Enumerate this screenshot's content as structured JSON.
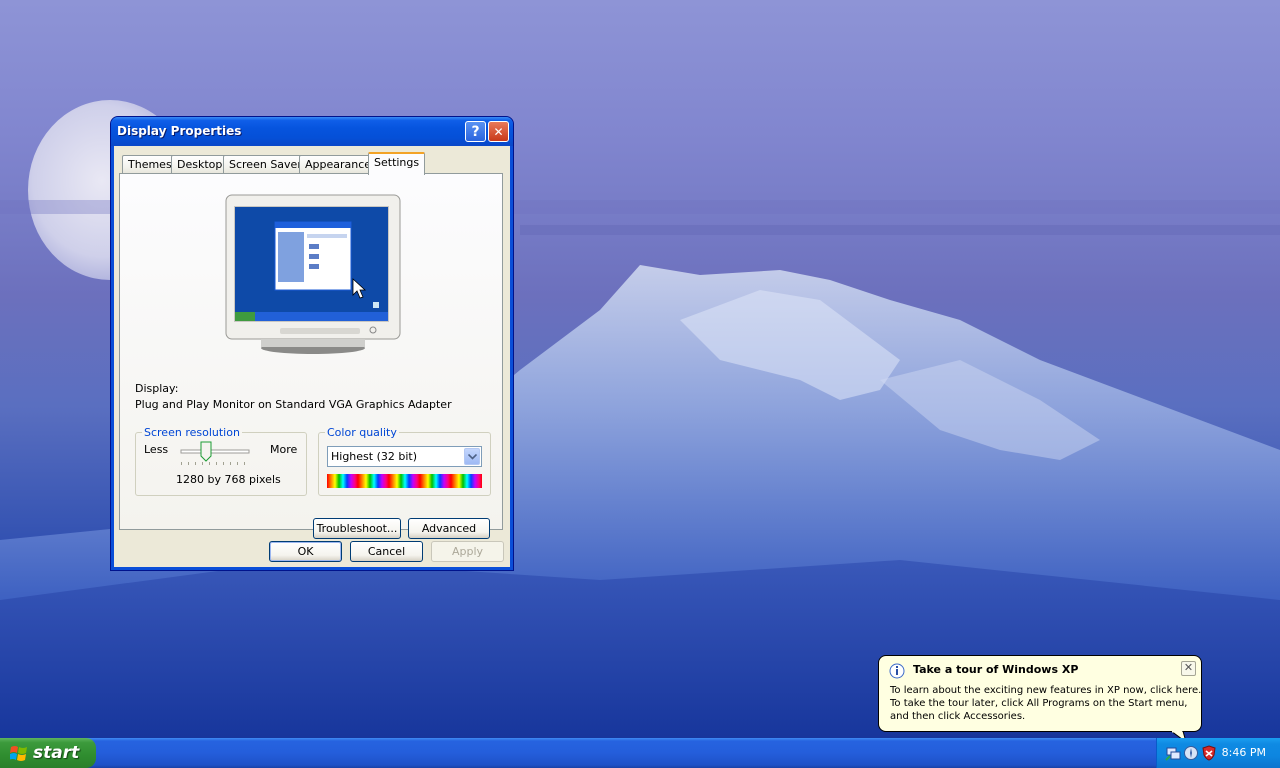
{
  "window": {
    "title": "Display Properties",
    "help_icon": "?",
    "close_icon": "✕"
  },
  "tabs": [
    {
      "label": "Themes"
    },
    {
      "label": "Desktop"
    },
    {
      "label": "Screen Saver"
    },
    {
      "label": "Appearance"
    },
    {
      "label": "Settings",
      "active": true
    }
  ],
  "settings": {
    "display_label": "Display:",
    "display_value": "Plug and Play Monitor on Standard VGA Graphics Adapter",
    "resolution": {
      "legend": "Screen resolution",
      "less": "Less",
      "more": "More",
      "value": "1280 by 768 pixels"
    },
    "color": {
      "legend": "Color quality",
      "selected": "Highest (32 bit)"
    },
    "troubleshoot": "Troubleshoot...",
    "advanced": "Advanced"
  },
  "dialog_buttons": {
    "ok": "OK",
    "cancel": "Cancel",
    "apply": "Apply"
  },
  "taskbar": {
    "start": "start",
    "clock": "8:46 PM"
  },
  "balloon": {
    "title": "Take a tour of Windows XP",
    "line1": "To learn about the exciting new features in XP now, click here.",
    "line2": "To take the tour later, click All Programs on the Start menu,",
    "line3": "and then click Accessories.",
    "close_icon": "✕"
  }
}
